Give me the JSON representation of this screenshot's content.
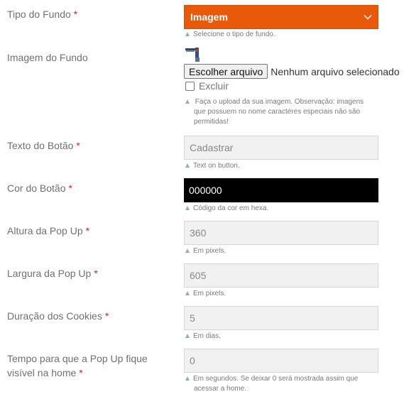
{
  "tipo_fundo": {
    "label": "Tipo do Fundo",
    "required": "*",
    "selected": "Imagem",
    "help": "Selecione o tipo de fundo."
  },
  "imagem_fundo": {
    "label": "Imagem do Fundo",
    "file_button": "Escolher arquivo",
    "file_status": "Nenhum arquivo selecionado",
    "delete_label": "Excluir",
    "help": "Faça o upload da sua imagem. Observação: imagens que possuem no nome caractéres especiais não são permitidas!"
  },
  "texto_botao": {
    "label": "Texto do Botão",
    "required": "*",
    "value": "Cadastrar",
    "help": "Text on button."
  },
  "cor_botao": {
    "label": "Cor do Botão",
    "required": "*",
    "value": "000000",
    "color": "#000000",
    "help": "Código da cor em hexa."
  },
  "altura": {
    "label": "Altura da Pop Up",
    "required": "*",
    "value": "360",
    "help": "Em pixels."
  },
  "largura": {
    "label": "Largura da Pop Up",
    "required": "*",
    "value": "605",
    "help": "Em pixels."
  },
  "duracao": {
    "label": "Duração dos Cookies",
    "required": "*",
    "value": "5",
    "help": "Em dias."
  },
  "tempo": {
    "label": "Tempo para que a Pop Up fique visível na home",
    "required": "*",
    "value": "0",
    "help": "Em segundos. Se deixar 0 será mostrada assim que acessar a home."
  },
  "colors": {
    "accent": "#e8590c",
    "required": "#e02020",
    "help_marker": "#8fb3a8"
  }
}
